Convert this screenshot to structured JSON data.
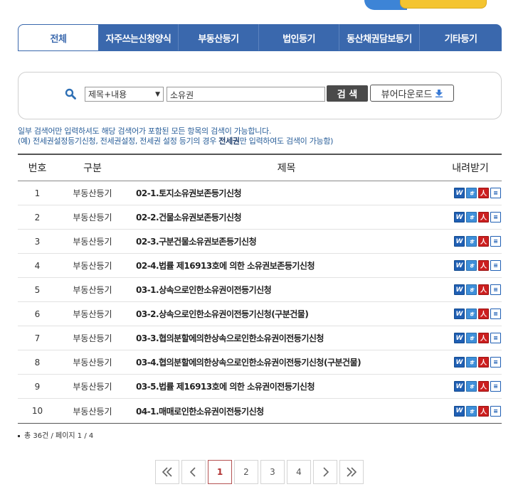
{
  "tabs": [
    {
      "label": "전체",
      "active": true
    },
    {
      "label": "자주쓰는신청양식",
      "active": false
    },
    {
      "label": "부동산등기",
      "active": false
    },
    {
      "label": "법인등기",
      "active": false
    },
    {
      "label": "동산채권담보등기",
      "active": false
    },
    {
      "label": "기타등기",
      "active": false
    }
  ],
  "search": {
    "select_value": "제목+내용",
    "query_value": "소유권",
    "search_label": "검 색",
    "viewer_label": "뷰어다운로드"
  },
  "notice": {
    "line1": "일부 검색어만 입력하셔도 해당 검색어가 포함된 모든 항목의 검색이 가능합니다.",
    "line2_pre": "(예) 전세권설정등기신청, 전세권설정, 전세권 설정 등기의 경우 ",
    "line2_bold": "전세권",
    "line2_post": "만 입력하여도 검색이 가능함)"
  },
  "table": {
    "headers": {
      "no": "번호",
      "category": "구분",
      "title": "제목",
      "download": "내려받기"
    },
    "rows": [
      {
        "no": "1",
        "category": "부동산등기",
        "title": "02-1.토지소유권보존등기신청"
      },
      {
        "no": "2",
        "category": "부동산등기",
        "title": "02-2.건물소유권보존등기신청"
      },
      {
        "no": "3",
        "category": "부동산등기",
        "title": "02-3.구분건물소유권보존등기신청"
      },
      {
        "no": "4",
        "category": "부동산등기",
        "title": "02-4.법률 제16913호에 의한 소유권보존등기신청"
      },
      {
        "no": "5",
        "category": "부동산등기",
        "title": "03-1.상속으로인한소유권이전등기신청"
      },
      {
        "no": "6",
        "category": "부동산등기",
        "title": "03-2.상속으로인한소유권이전등기신청(구분건물)"
      },
      {
        "no": "7",
        "category": "부동산등기",
        "title": "03-3.협의분할에의한상속으로인한소유권이전등기신청"
      },
      {
        "no": "8",
        "category": "부동산등기",
        "title": "03-4.협의분할에의한상속으로인한소유권이전등기신청(구분건물)"
      },
      {
        "no": "9",
        "category": "부동산등기",
        "title": "03-5.법률 제16913호에 의한 소유권이전등기신청"
      },
      {
        "no": "10",
        "category": "부동산등기",
        "title": "04-1.매매로인한소유권이전등기신청"
      }
    ],
    "file_icons": [
      "word-file-icon",
      "hwp-file-icon",
      "pdf-file-icon",
      "text-file-icon"
    ]
  },
  "summary": {
    "text": "총 36건 / 페이지 1 / 4"
  },
  "pagination": {
    "pages": [
      "1",
      "2",
      "3",
      "4"
    ],
    "current": "1"
  },
  "colors": {
    "tab_bg": "#3a68ad",
    "notice": "#2a5f9a",
    "current_page": "#b03030"
  }
}
